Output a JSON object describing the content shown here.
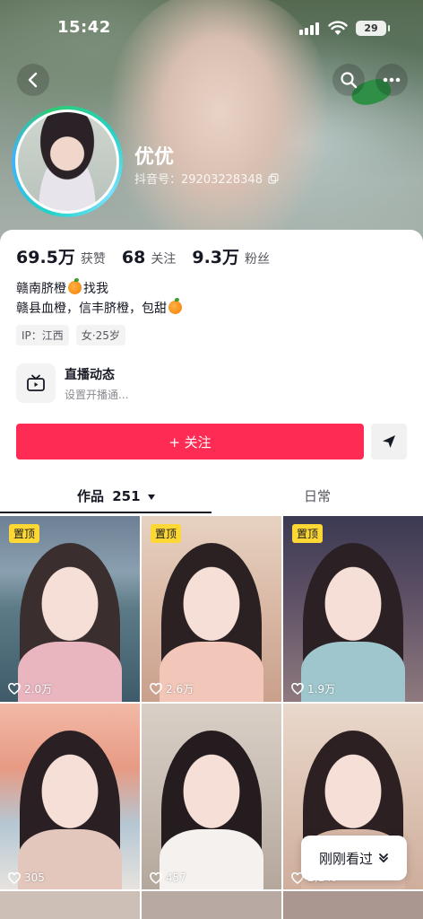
{
  "status_bar": {
    "time": "15:42",
    "battery": "29"
  },
  "profile": {
    "nickname": "优优",
    "douyin_id": "抖音号：29203228348"
  },
  "stats": [
    {
      "value": "69.5万",
      "label": "获赞"
    },
    {
      "value": "68",
      "label": "关注"
    },
    {
      "value": "9.3万",
      "label": "粉丝"
    }
  ],
  "bio": {
    "line1_text": "赣南脐橙",
    "line1_suffix": "找我",
    "line2_text": "赣县血橙，信丰脐橙，包甜"
  },
  "tags": [
    "IP：江西",
    "女·25岁"
  ],
  "live": {
    "title": "直播动态",
    "subtitle": "设置开播通..."
  },
  "actions": {
    "follow_label": "+ 关注"
  },
  "tabs": {
    "works_label": "作品",
    "works_count": "251",
    "daily_label": "日常"
  },
  "grid": {
    "pinned_label": "置顶",
    "likes": [
      "2.0万",
      "2.6万",
      "1.9万",
      "305",
      "457",
      "2,149"
    ]
  },
  "recent_button": {
    "label": "刚刚看过"
  },
  "colors": {
    "accent": "#fe2c55",
    "pin": "#fdd835"
  }
}
